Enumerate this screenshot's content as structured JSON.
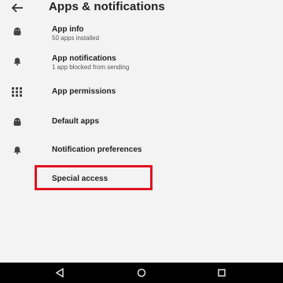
{
  "header": {
    "back_icon": "arrow-back-icon",
    "title": "Apps & notifications"
  },
  "items": [
    {
      "icon": "android-icon",
      "label": "App info",
      "sub": "50 apps installed"
    },
    {
      "icon": "bell-icon",
      "label": "App notifications",
      "sub": "1 app blocked from sending"
    },
    {
      "icon": "grid-icon",
      "label": "App permissions"
    },
    {
      "icon": "android-icon",
      "label": "Default apps"
    },
    {
      "icon": "bell-icon",
      "label": "Notification preferences"
    }
  ],
  "special_access": {
    "label": "Special access",
    "highlight_color": "#e0121f"
  },
  "navbar": {
    "back": "nav-back-icon",
    "home": "nav-home-icon",
    "recents": "nav-recents-icon"
  }
}
